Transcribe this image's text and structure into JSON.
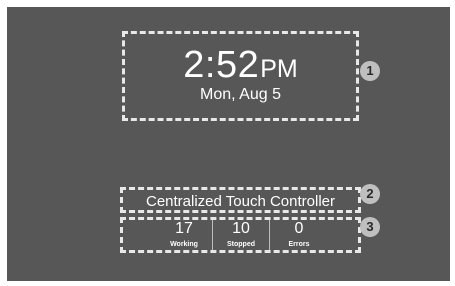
{
  "clock": {
    "time": "2:52",
    "ampm": "PM",
    "date": "Mon, Aug 5"
  },
  "controller": {
    "title": "Centralized Touch Controller"
  },
  "stats": [
    {
      "value": "17",
      "label": "Working"
    },
    {
      "value": "10",
      "label": "Stopped"
    },
    {
      "value": "0",
      "label": "Errors"
    }
  ],
  "callouts": [
    "1",
    "2",
    "3"
  ],
  "colors": {
    "screen_background": "#575757",
    "outline": "#e8e8e8",
    "callout_badge": "#bfbfbf",
    "text": "#ffffff"
  }
}
